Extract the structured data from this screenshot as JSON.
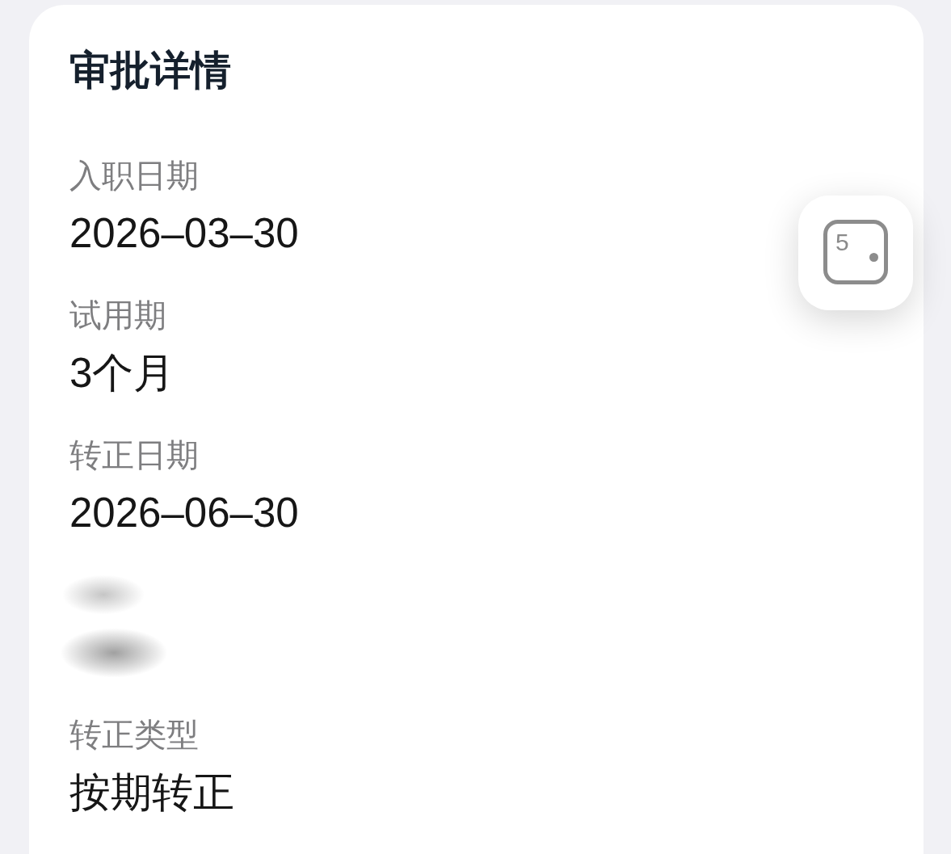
{
  "header": {
    "title": "审批详情"
  },
  "fields": [
    {
      "kind": "text",
      "label": "入职日期",
      "value": "2026–03–30"
    },
    {
      "kind": "text",
      "label": "试用期",
      "value": "3个月"
    },
    {
      "kind": "text",
      "label": "转正日期",
      "value": "2026–06–30"
    },
    {
      "kind": "blurred"
    },
    {
      "kind": "text",
      "label": "转正类型",
      "value": "按期转正"
    }
  ],
  "floating_button": {
    "label": "5"
  }
}
